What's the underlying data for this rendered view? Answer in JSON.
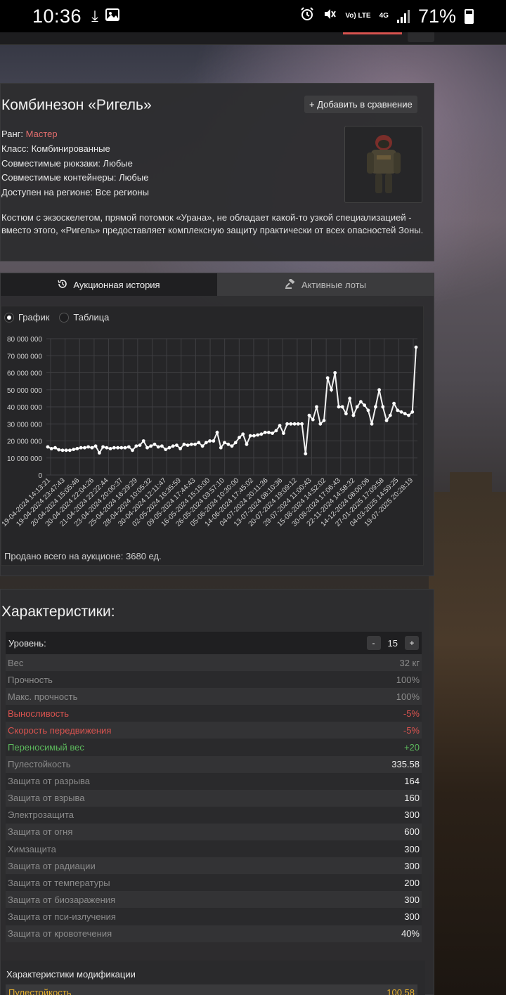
{
  "status_bar": {
    "time": "10:36",
    "battery": "71%",
    "network": "4G",
    "volte": "Vo) LTE"
  },
  "item": {
    "title": "Комбинезон «Ригель»",
    "compare_button": "+ Добавить в сравнение",
    "rank_label": "Ранг:",
    "rank_value": "Мастер",
    "class": "Класс: Комбинированные",
    "backpacks": "Совместимые рюкзаки: Любые",
    "containers": "Совместимые контейнеры: Любые",
    "region": "Доступен на регионе: Все регионы",
    "description": "Костюм с экзоскелетом, прямой потомок «Урана», не обладает какой-то узкой специализацией - вместо этого, «Ригель» предоставляет комплексную защиту практически от всех опасностей Зоны."
  },
  "tabs": {
    "auction_history": "Аукционная история",
    "active_lots": "Активные лоты"
  },
  "view_toggle": {
    "chart": "График",
    "table": "Таблица",
    "selected": "chart"
  },
  "sold_total": "Продано всего на аукционе: 3680 ед.",
  "chart_data": {
    "type": "line",
    "ylim": [
      0,
      80000000
    ],
    "yticks": [
      "0",
      "10 000 000",
      "20 000 000",
      "30 000 000",
      "40 000 000",
      "50 000 000",
      "60 000 000",
      "70 000 000",
      "80 000 000"
    ],
    "xtick_labels": [
      "19-04-2024 14:13:21",
      "19-04-2024 23:47:43",
      "20-04-2024 15:05:46",
      "20-04-2024 22:04:26",
      "21-04-2024 22:22:44",
      "23-04-2024 20:00:37",
      "25-04-2024 16:29:29",
      "28-04-2024 10:05:32",
      "30-04-2024 12:11:47",
      "02-05-2024 16:35:59",
      "09-05-2024 17:44:43",
      "16-05-2024 15:15:00",
      "26-05-2024 03:57:10",
      "05-06-2024 10:30:00",
      "14-06-2024 17:45:02",
      "04-07-2024 20:11:36",
      "13-07-2024 08:10:36",
      "20-07-2024 19:09:12",
      "29-07-2024 11:00:43",
      "15-08-2024 14:52:02",
      "30-08-2024 17:06:43",
      "22-11-2024 14:58:32",
      "14-12-2024 08:00:06",
      "27-01-2025 17:09:58",
      "04-03-2025 14:59:25",
      "19-07-2025 20:28:19"
    ],
    "series": [
      {
        "values": [
          16500000,
          15500000,
          16000000,
          14800000,
          14500000,
          14500000,
          14500000,
          15000000,
          15500000,
          16000000,
          16000000,
          16500000,
          16000000,
          17000000,
          13000000,
          16500000,
          16000000,
          15500000,
          16000000,
          16000000,
          16000000,
          16000000,
          16500000,
          14500000,
          17000000,
          17500000,
          20000000,
          16000000,
          17000000,
          18000000,
          16500000,
          17000000,
          15000000,
          16000000,
          17000000,
          17500000,
          15500000,
          18000000,
          17500000,
          18000000,
          18000000,
          19000000,
          17000000,
          19000000,
          20000000,
          20000000,
          25000000,
          16000000,
          19000000,
          18000000,
          17000000,
          19000000,
          22000000,
          24000000,
          18000000,
          23000000,
          23000000,
          23500000,
          24000000,
          25000000,
          25000000,
          24500000,
          26000000,
          29000000,
          24500000,
          30000000,
          30000000,
          30000000,
          30000000,
          30000000,
          12500000,
          35000000,
          32500000,
          40000000,
          30000000,
          32000000,
          57000000,
          50000000,
          60000000,
          40000000,
          40000000,
          36000000,
          45000000,
          35000000,
          40000000,
          43000000,
          41000000,
          38000000,
          30000000,
          40000000,
          50000000,
          40000000,
          32000000,
          35000000,
          42000000,
          38000000,
          37000000,
          36000000,
          35000000,
          37000000,
          75000000
        ]
      }
    ]
  },
  "characteristics": {
    "title": "Характеристики:",
    "level_label": "Уровень:",
    "level_value": "15",
    "level_minus": "-",
    "level_plus": "+",
    "rows": [
      {
        "name": "Вес",
        "value": "32 кг",
        "style": "muted"
      },
      {
        "name": "Прочность",
        "value": "100%",
        "style": "muted"
      },
      {
        "name": "Макс. прочность",
        "value": "100%",
        "style": "muted"
      },
      {
        "name": "Выносливость",
        "value": "-5%",
        "style": "red"
      },
      {
        "name": "Скорость передвижения",
        "value": "-5%",
        "style": "red"
      },
      {
        "name": "Переносимый вес",
        "value": "+20",
        "style": "green"
      },
      {
        "name": "Пулестойкость",
        "value": "335.58",
        "style": "muted-white"
      },
      {
        "name": "Защита от разрыва",
        "value": "164",
        "style": "muted-white"
      },
      {
        "name": "Защита от взрыва",
        "value": "160",
        "style": "muted-white"
      },
      {
        "name": "Электрозащита",
        "value": "300",
        "style": "muted-white"
      },
      {
        "name": "Защита от огня",
        "value": "600",
        "style": "muted-white"
      },
      {
        "name": "Химзащита",
        "value": "300",
        "style": "muted-white"
      },
      {
        "name": "Защита от радиации",
        "value": "300",
        "style": "muted-white"
      },
      {
        "name": "Защита от температуры",
        "value": "200",
        "style": "muted-white"
      },
      {
        "name": "Защита от биозаражения",
        "value": "300",
        "style": "muted-white"
      },
      {
        "name": "Защита от пси-излучения",
        "value": "300",
        "style": "muted-white"
      },
      {
        "name": "Защита от кровотечения",
        "value": "40%",
        "style": "muted-white"
      }
    ],
    "mod_title": "Характеристики модификации",
    "mod_row": {
      "name": "Пулестойкость",
      "value": "100.58"
    }
  },
  "colors": {
    "accent_red": "#d9534f",
    "accent_green": "#5cb85c",
    "mod_gold": "#e6b02e",
    "rank_color": "#e26d6d"
  }
}
